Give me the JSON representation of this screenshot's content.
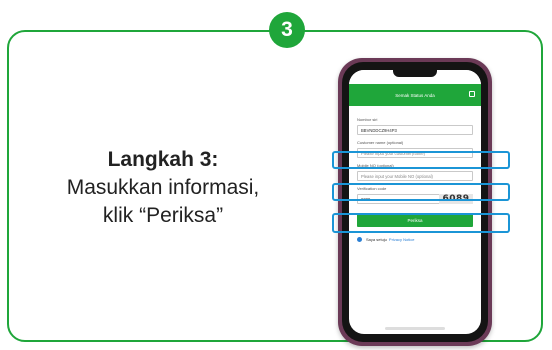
{
  "step": {
    "number": "3",
    "title": "Langkah 3:",
    "line1": "Masukkan informasi,",
    "line2": "klik “Periksa”"
  },
  "app": {
    "header_title": "Semak Status Anda",
    "fields": [
      {
        "label": "Nombor siri",
        "value": "BBVNDDCZ9H4P3",
        "placeholder": false
      },
      {
        "label": "Customer name (optional)",
        "value": "Please input your customer(name)",
        "placeholder": true
      },
      {
        "label": "Mobile NO (optional)",
        "value": "Please input your Mobile NO (optional)",
        "placeholder": true
      },
      {
        "label": "Verification code",
        "value": "6089",
        "placeholder": false
      }
    ],
    "captcha": "6089",
    "check_button": "Periksa",
    "agree_text": "Saya setuju",
    "agree_link": "Privacy Notice"
  },
  "colors": {
    "accent": "#1fa63a",
    "highlight": "#1b95d6",
    "phone_frame": "#6b3a57"
  }
}
